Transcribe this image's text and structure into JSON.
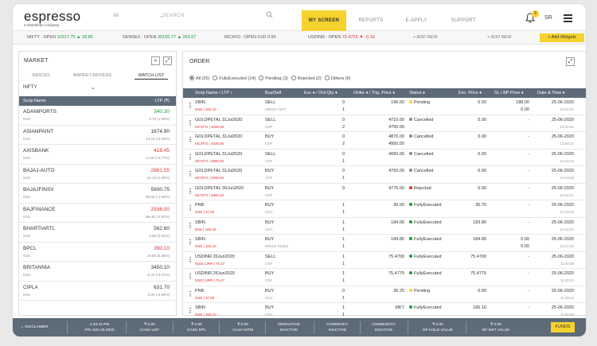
{
  "header": {
    "logo": "espresso",
    "logo_sub": "a sharekhan company",
    "segment": "All",
    "search_placeholder": "SEARCH",
    "tabs": [
      "MY SCREEN",
      "REPORTS",
      "E-APPLY",
      "SUPPORT"
    ],
    "notification_count": "9",
    "user_initials": "SR",
    "colors": {
      "accent": "#f6d22e",
      "positive": "#1a9a3a",
      "negative": "#dd3333",
      "table_header": "#5d6a78"
    }
  },
  "ticker": {
    "items": [
      {
        "label": "NIFTY : OPEN",
        "value": "10317.75",
        "arrow": "▲",
        "change": "28.85",
        "dir": "up"
      },
      {
        "label": "SENSEX : OPEN",
        "value": "35105.77",
        "arrow": "▲",
        "change": "263.67",
        "dir": "up"
      },
      {
        "label": "MCXFO : OPEN",
        "value": "0.00",
        "arrow": "",
        "change": "0.00",
        "dir": "flat"
      },
      {
        "label": "USDINR : OPEN",
        "value": "75.4725",
        "arrow": "▼",
        "change": "-0.16",
        "dir": "down"
      }
    ],
    "add_new": [
      "+ ADD NEW",
      "+ ADD NEW"
    ],
    "add_widgets": "+ Add Widgets"
  },
  "market": {
    "title": "MARKET",
    "tabs": [
      "INDICES",
      "MARKET MOVERS",
      "WATCH LIST"
    ],
    "active_tab": "WATCH LIST",
    "selected_list": "NIFTY",
    "columns": [
      "Scrip Name",
      "LTP (₹)"
    ],
    "rows": [
      {
        "symbol": "ADANIPORTS",
        "exchange": "NSE",
        "ltp": "340.30",
        "change": "3.70 (1.08%)",
        "dir": "up"
      },
      {
        "symbol": "ASIANPAINT",
        "exchange": "NSE",
        "ltp": "1674.90",
        "change": "-14.10 (-0.83%)",
        "dir": "flat"
      },
      {
        "symbol": "AXISBANK",
        "exchange": "NSE",
        "ltp": "418.45",
        "change": "+3.25 (+0.77%)",
        "dir": "down"
      },
      {
        "symbol": "BAJAJ-AUTO",
        "exchange": "NSE",
        "ltp": "2861.55",
        "change": "41.10 (1.46%)",
        "dir": "down"
      },
      {
        "symbol": "BAJAJFINSV",
        "exchange": "NSE",
        "ltp": "5930.75",
        "change": "-90.80 (-1.50%)",
        "dir": "flat"
      },
      {
        "symbol": "BAJFINANCE",
        "exchange": "NSE",
        "ltp": "2936.00",
        "change": "-86.35 (-2.87%)",
        "dir": "down"
      },
      {
        "symbol": "BHARTIARTL",
        "exchange": "NSE",
        "ltp": "562.60",
        "change": "3.60 (0.64%)",
        "dir": "flat"
      },
      {
        "symbol": "BPCL",
        "exchange": "NSE",
        "ltp": "390.10",
        "change": "19.85 (5.36%)",
        "dir": "down"
      },
      {
        "symbol": "BRITANNIA",
        "exchange": "NSE",
        "ltp": "3450.10",
        "change": "-0.30 (-0.01%)",
        "dir": "flat"
      },
      {
        "symbol": "CIPLA",
        "exchange": "NSE",
        "ltp": "631.70",
        "change": "-3.20 (-0.50%)",
        "dir": "flat"
      }
    ]
  },
  "order": {
    "title": "ORDER",
    "filters": [
      {
        "label": "All (25)",
        "selected": true
      },
      {
        "label": "FullyExecuted (14)",
        "selected": false
      },
      {
        "label": "Pending (3)",
        "selected": false
      },
      {
        "label": "Rejected (2)",
        "selected": false
      },
      {
        "label": "Others (6)",
        "selected": false
      }
    ],
    "columns": [
      "Scrip Name / LTP ↕",
      "Buy/Sell",
      "Exc ♦ / Ord Qty ♦",
      "Order ♦ / Trig. Price ♦",
      "Status ♦",
      "Exc. Price ♦",
      "SL / BP Price ♦",
      "Date & Time ♦"
    ],
    "rows": [
      {
        "scrip": "SBIN",
        "sub": "NSE | 184.10",
        "side": "SELL",
        "product": "MRGN / MTF",
        "qty1": "0",
        "qty2": "1",
        "price1": "196.60",
        "price2": "",
        "status": "Pending",
        "status_color": "#f6d22e",
        "exc": "0.00",
        "sl1": "188.00",
        "sl2": "0.00",
        "date": "25-06-2020",
        "time": "13:41:01"
      },
      {
        "scrip": "GOLDPETAL 31Jul2020",
        "sub": "MCXFO | 4936.00",
        "side": "SELL",
        "product": "CNF",
        "qty1": "0",
        "qty2": "2",
        "price1": "4710.00",
        "price2": "4750.00",
        "status": "Cancelled",
        "status_color": "#888888",
        "exc": "0.00",
        "sl1": "-",
        "sl2": "",
        "date": "25-06-2020",
        "time": "13:22:51"
      },
      {
        "scrip": "GOLDPETAL 31Jul2020",
        "sub": "MCXFO | 4936.00",
        "side": "BUY",
        "product": "CNF",
        "qty1": "0",
        "qty2": "2",
        "price1": "4870.00",
        "price2": "4950.00",
        "status": "Cancelled",
        "status_color": "#888888",
        "exc": "0.00",
        "sl1": "-",
        "sl2": "",
        "date": "25-06-2020",
        "time": "12:58:21"
      },
      {
        "scrip": "GOLDPETAL 31Jul2020",
        "sub": "MCXFO | 4896.00",
        "side": "SELL",
        "product": "CNF",
        "qty1": "0",
        "qty2": "1",
        "price1": "4050.00",
        "price2": "",
        "status": "Cancelled",
        "status_color": "#888888",
        "exc": "0.00",
        "sl1": "-",
        "sl2": "",
        "date": "25-06-2020",
        "time": "12:54:34"
      },
      {
        "scrip": "GOLDPETAL 31Jul2020",
        "sub": "MCXFO | 4936.00",
        "side": "BUY",
        "product": "CNF",
        "qty1": "0",
        "qty2": "1",
        "price1": "4750.00",
        "price2": "",
        "status": "Cancelled",
        "status_color": "#888888",
        "exc": "0.00",
        "sl1": "-",
        "sl2": "",
        "date": "25-06-2020",
        "time": "12:53:48"
      },
      {
        "scrip": "GOLDPETAL 30Jun2020",
        "sub": "MCXFO | 4860.00",
        "side": "BUY",
        "product": "CNF",
        "qty1": "0",
        "qty2": "",
        "price1": "4775.00",
        "price2": "",
        "status": "Rejected",
        "status_color": "#dd3333",
        "exc": "0.00",
        "sl1": "-",
        "sl2": "",
        "date": "25-06-2020",
        "time": "12:52:41"
      },
      {
        "scrip": "PNB",
        "sub": "NSE | 37.00",
        "side": "BUY",
        "product": "CNC",
        "qty1": "1",
        "qty2": "1",
        "price1": "36.00",
        "price2": "",
        "status": "FullyExecuted",
        "status_color": "#1a9a3a",
        "exc": "36.75",
        "sl1": "-",
        "sl2": "",
        "date": "25-06-2020",
        "time": "12:43:48"
      },
      {
        "scrip": "SBIN",
        "sub": "BSE | 185.00",
        "side": "BUY",
        "product": "CNC",
        "qty1": "1",
        "qty2": "1",
        "price1": "184.00",
        "price2": "",
        "status": "FullyExecuted",
        "status_color": "#1a9a3a",
        "exc": "183.80",
        "sl1": "-",
        "sl2": "",
        "date": "25-06-2020",
        "time": "12:41:04"
      },
      {
        "scrip": "SBIN",
        "sub": "NSE | 184.10",
        "side": "BUY",
        "product": "MRGN Traded",
        "qty1": "1",
        "qty2": "1",
        "price1": "184.85",
        "price2": "",
        "status": "FullyExecuted",
        "status_color": "#1a9a3a",
        "exc": "184.85",
        "sl1": "0.00",
        "sl2": "0.00",
        "date": "25-06-2020",
        "time": "12:37:20"
      },
      {
        "scrip": "USDINR 26Jun2020",
        "sub": "NSECURR | 75.47",
        "side": "SELL",
        "product": "CNF",
        "qty1": "1",
        "qty2": "1",
        "price1": "75.4700",
        "price2": "",
        "status": "FullyExecuted",
        "status_color": "#1a9a3a",
        "exc": "75.4700",
        "sl1": "-",
        "sl2": "",
        "date": "25-06-2020",
        "time": "11:40:59"
      },
      {
        "scrip": "USDINR 26Jun2020",
        "sub": "NSECURR | 75.47",
        "side": "BUY",
        "product": "CNF",
        "qty1": "1",
        "qty2": "1",
        "price1": "75.4775",
        "price2": "",
        "status": "FullyExecuted",
        "status_color": "#1a9a3a",
        "exc": "75.4775",
        "sl1": "-",
        "sl2": "",
        "date": "25-06-2020",
        "time": "11:40:24"
      },
      {
        "scrip": "PNB",
        "sub": "NSE | 37.00",
        "side": "BUY",
        "product": "CNC",
        "qty1": "0",
        "qty2": "1",
        "price1": "36.25",
        "price2": "",
        "status": "Pending",
        "status_color": "#f6d22e",
        "exc": "0.00",
        "sl1": "-",
        "sl2": "",
        "date": "25-06-2020",
        "time": "11:39:22"
      },
      {
        "scrip": "SBIN",
        "sub": "NSE | 184.10",
        "side": "BUY",
        "product": "CNC",
        "qty1": "1",
        "qty2": "1",
        "price1": "MKT",
        "price2": "",
        "status": "FullyExecuted",
        "status_color": "#1a9a3a",
        "exc": "186.10",
        "sl1": "-",
        "sl2": "",
        "date": "25-06-2020",
        "time": "11:35:48"
      }
    ]
  },
  "footer": {
    "disclaimer": "DISCLAIMER",
    "time": "1:43:44 PM",
    "date": "FRI JUN 26 2020",
    "stats": [
      {
        "value": "₹ 0.00",
        "label": "CASH LMT"
      },
      {
        "value": "₹ 0.00",
        "label": "CASH DPL"
      },
      {
        "value": "₹ 0.00",
        "label": "CASH MTM"
      },
      {
        "value": "DERIVATIVE",
        "label": "INACTIVE"
      },
      {
        "value": "CURRENCY",
        "label": "INACTIVE"
      },
      {
        "value": "COMMODITY",
        "label": "INACTIVE"
      },
      {
        "value": "₹ 0.00",
        "label": "DP HOLD VALUE"
      },
      {
        "value": "₹ 0.00",
        "label": "DP MKT VALUE"
      }
    ],
    "funds": "FUNDS"
  }
}
